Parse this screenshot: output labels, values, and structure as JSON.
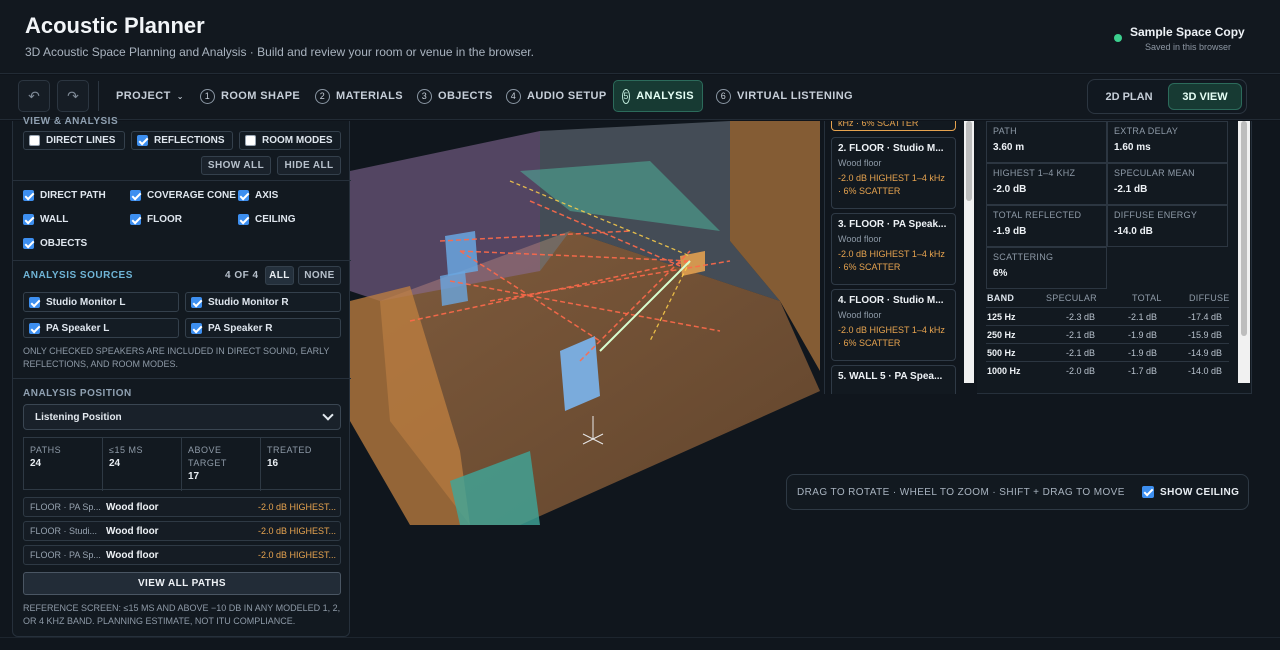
{
  "app": {
    "title": "Acoustic Planner",
    "subtitle": "3D Acoustic Space Planning and Analysis · Build and review your room or venue in the browser.",
    "space_name": "Sample Space Copy",
    "save_status": "Saved in this browser",
    "status_color": "#3ccf8e"
  },
  "nav": {
    "undo_icon": "undo-icon",
    "redo_icon": "redo-icon",
    "project_label": "PROJECT",
    "steps": [
      {
        "num": "1",
        "label": "ROOM SHAPE"
      },
      {
        "num": "2",
        "label": "MATERIALS"
      },
      {
        "num": "3",
        "label": "OBJECTS"
      },
      {
        "num": "4",
        "label": "AUDIO SETUP"
      },
      {
        "num": "5",
        "label": "ANALYSIS"
      },
      {
        "num": "6",
        "label": "VIRTUAL LISTENING"
      }
    ],
    "active_step": "5",
    "view_2d": "2D PLAN",
    "view_3d": "3D VIEW",
    "active_view": "3D VIEW",
    "accent_color": "#173a33"
  },
  "left": {
    "cut_heading": "VIEW & ANALYSIS",
    "toggles": [
      {
        "label": "DIRECT LINES",
        "checked": false
      },
      {
        "label": "REFLECTIONS",
        "checked": true
      },
      {
        "label": "ROOM MODES",
        "checked": false
      }
    ],
    "show_all": "SHOW ALL",
    "hide_all": "HIDE ALL",
    "layers": [
      {
        "label": "DIRECT PATH",
        "checked": true
      },
      {
        "label": "COVERAGE CONE",
        "checked": true
      },
      {
        "label": "AXIS",
        "checked": true
      },
      {
        "label": "WALL",
        "checked": true
      },
      {
        "label": "FLOOR",
        "checked": true
      },
      {
        "label": "CEILING",
        "checked": true
      },
      {
        "label": "OBJECTS",
        "checked": true
      }
    ],
    "sources_heading": "ANALYSIS SOURCES",
    "sources_count": "4 OF 4",
    "all_label": "ALL",
    "none_label": "NONE",
    "sources": [
      {
        "label": "Studio Monitor L",
        "checked": true
      },
      {
        "label": "Studio Monitor R",
        "checked": true
      },
      {
        "label": "PA Speaker L",
        "checked": true
      },
      {
        "label": "PA Speaker R",
        "checked": true
      }
    ],
    "sources_note": "ONLY CHECKED SPEAKERS ARE INCLUDED IN DIRECT SOUND, EARLY REFLECTIONS, AND ROOM MODES.",
    "position_heading": "ANALYSIS POSITION",
    "position_value": "Listening Position",
    "stats": [
      {
        "label": "PATHS",
        "value": "24"
      },
      {
        "label": "≤15 MS",
        "value": "24"
      },
      {
        "label": "ABOVE TARGET",
        "value": "17"
      },
      {
        "label": "TREATED",
        "value": "16"
      }
    ],
    "paths": [
      {
        "source": "FLOOR · PA Sp...",
        "material": "Wood floor",
        "result": "-2.0 dB HIGHEST..."
      },
      {
        "source": "FLOOR · Studi...",
        "material": "Wood floor",
        "result": "-2.0 dB HIGHEST..."
      },
      {
        "source": "FLOOR · PA Sp...",
        "material": "Wood floor",
        "result": "-2.0 dB HIGHEST..."
      }
    ],
    "view_all": "VIEW ALL PATHS",
    "reference": "REFERENCE SCREEN: ≤15 MS AND ABOVE −10 DB IN ANY MODELED 1, 2, OR 4 KHZ BAND. PLANNING ESTIMATE, NOT ITU COMPLIANCE."
  },
  "path_list": {
    "cut_top": "kHz · 6% SCATTER",
    "cards": [
      {
        "title": "2. FLOOR · Studio M...",
        "material": "Wood floor",
        "result": "-2.0 dB HIGHEST 1–4 kHz · 6% SCATTER"
      },
      {
        "title": "3. FLOOR · PA Speak...",
        "material": "Wood floor",
        "result": "-2.0 dB HIGHEST 1–4 kHz · 6% SCATTER"
      },
      {
        "title": "4. FLOOR · Studio M...",
        "material": "Wood floor",
        "result": "-2.0 dB HIGHEST 1–4 kHz · 6% SCATTER"
      },
      {
        "title": "5. WALL 5 · PA Spea...",
        "material": "",
        "result": ""
      }
    ]
  },
  "detail": {
    "cells": [
      {
        "label": "PATH",
        "value": "3.60 m"
      },
      {
        "label": "EXTRA DELAY",
        "value": "1.60 ms"
      },
      {
        "label": "HIGHEST 1–4 KHZ",
        "value": "-2.0 dB"
      },
      {
        "label": "SPECULAR MEAN",
        "value": "-2.1 dB"
      },
      {
        "label": "TOTAL REFLECTED",
        "value": "-1.9 dB"
      },
      {
        "label": "DIFFUSE ENERGY",
        "value": "-14.0 dB"
      },
      {
        "label": "SCATTERING",
        "value": "6%"
      }
    ],
    "band_headers": [
      "BAND",
      "SPECULAR",
      "TOTAL",
      "DIFFUSE"
    ],
    "bands": [
      {
        "band": "125 Hz",
        "specular": "-2.3 dB",
        "total": "-2.1 dB",
        "diffuse": "-17.4 dB"
      },
      {
        "band": "250 Hz",
        "specular": "-2.1 dB",
        "total": "-1.9 dB",
        "diffuse": "-15.9 dB"
      },
      {
        "band": "500 Hz",
        "specular": "-2.1 dB",
        "total": "-1.9 dB",
        "diffuse": "-14.9 dB"
      },
      {
        "band": "1000 Hz",
        "specular": "-2.0 dB",
        "total": "-1.7 dB",
        "diffuse": "-14.0 dB"
      }
    ]
  },
  "hint": {
    "text": "DRAG TO ROTATE · WHEEL TO ZOOM · SHIFT + DRAG TO MOVE",
    "show_ceiling": "SHOW CEILING",
    "show_ceiling_checked": true
  }
}
